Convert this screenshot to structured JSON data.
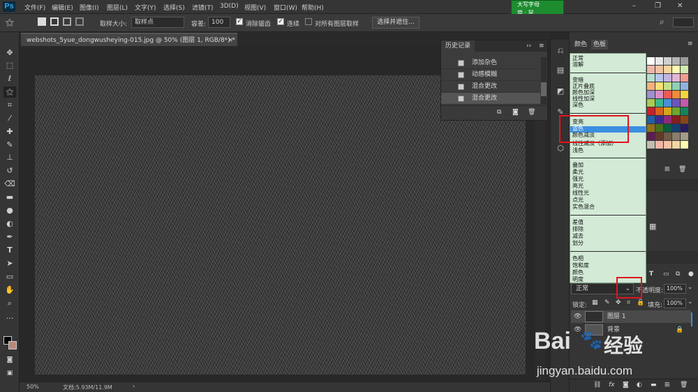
{
  "app": {
    "logo": "Ps"
  },
  "menu": [
    "文件(F)",
    "编辑(E)",
    "图像(I)",
    "图层(L)",
    "文字(Y)",
    "选择(S)",
    "滤镜(T)",
    "3D(D)",
    "视图(V)",
    "窗口(W)",
    "帮助(H)"
  ],
  "ime": {
    "line1": "大写字母",
    "line2": "简 · 鼠"
  },
  "options": {
    "sample_size_label": "取样大小:",
    "sample_size_value": "取样点",
    "tolerance_label": "容差:",
    "tolerance_value": "100",
    "antialias": "消除锯齿",
    "contiguous": "连续",
    "all_layers": "对所有图层取样",
    "refine_button": "选择并遮住..."
  },
  "document": {
    "tab_title": "webshots_5yue_dongwusheying-015.jpg @ 50% (图层 1, RGB/8*) *",
    "close": "×"
  },
  "status": {
    "zoom": "50%",
    "doc_info": "文档:5.93M/11.9M",
    "arrow": "›"
  },
  "history": {
    "title": "历史记录",
    "items": [
      "添加杂色",
      "动感模糊",
      "混合更改",
      "混合更改"
    ]
  },
  "panels": {
    "tab_color": "颜色",
    "tab_swatches": "色板"
  },
  "blend_menu": {
    "groups": [
      [
        "正常",
        "溶解"
      ],
      [
        "变暗",
        "正片叠底",
        "颜色加深",
        "线性加深",
        "深色"
      ],
      [
        "变亮",
        "滤色",
        "颜色减淡",
        "线性减淡（添加）",
        "浅色"
      ],
      [
        "叠加",
        "柔光",
        "强光",
        "亮光",
        "线性光",
        "点光",
        "实色混合"
      ],
      [
        "差值",
        "排除",
        "减去",
        "划分"
      ],
      [
        "色相",
        "饱和度",
        "颜色",
        "明度"
      ]
    ],
    "highlighted": "滤色"
  },
  "layers": {
    "blend_mode": "正常",
    "opacity_label": "不透明度:",
    "opacity_value": "100%",
    "lock_label": "锁定:",
    "fill_label": "填充:",
    "fill_value": "100%",
    "items": [
      {
        "name": "图层 1",
        "selected": true
      },
      {
        "name": "背景",
        "selected": false
      }
    ]
  },
  "watermark": {
    "brand": "Bai",
    "suffix": "经验",
    "url": "jingyan.baidu.com"
  },
  "colors": {
    "menu_highlight": "#3b8ee0",
    "dropdown_bg": "#d2ead6",
    "annotation_red": "#e0141e",
    "ime_green": "#1d8c2f"
  }
}
